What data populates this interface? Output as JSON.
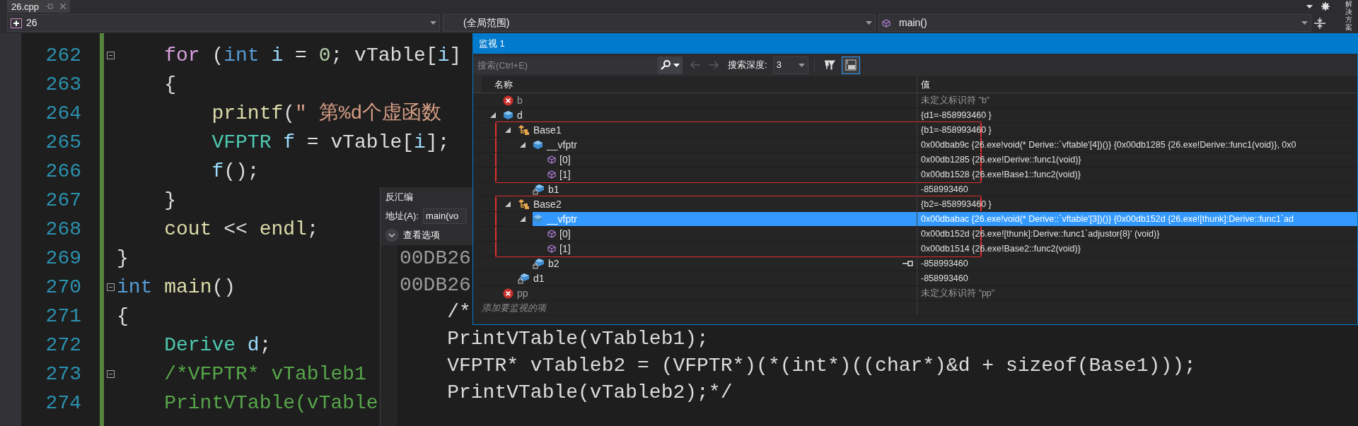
{
  "tab": {
    "title": "26.cpp"
  },
  "navbar": {
    "project": "26",
    "scope": "(全局范围)",
    "member": "main()"
  },
  "side_tab": {
    "label": "解决方案"
  },
  "editor": {
    "lines": [
      {
        "number": "262",
        "foldable": true,
        "tokens": [
          {
            "text": "    for",
            "kind": "control"
          },
          {
            "text": " (",
            "kind": "plain"
          },
          {
            "text": "int",
            "kind": "keyword"
          },
          {
            "text": " i",
            "kind": "variable"
          },
          {
            "text": " = ",
            "kind": "plain"
          },
          {
            "text": "0",
            "kind": "number"
          },
          {
            "text": "; vTable[",
            "kind": "plain"
          },
          {
            "text": "i",
            "kind": "variable"
          },
          {
            "text": "]",
            "kind": "plain"
          }
        ]
      },
      {
        "number": "263",
        "foldable": false,
        "tokens": [
          {
            "text": "    {",
            "kind": "plain"
          }
        ]
      },
      {
        "number": "264",
        "foldable": false,
        "tokens": [
          {
            "text": "        printf",
            "kind": "function"
          },
          {
            "text": "(",
            "kind": "plain"
          },
          {
            "text": "″ 第%d个虚函数",
            "kind": "string"
          }
        ]
      },
      {
        "number": "265",
        "foldable": false,
        "tokens": [
          {
            "text": "        VFPTR",
            "kind": "type"
          },
          {
            "text": " f",
            "kind": "variable"
          },
          {
            "text": " = vTable[",
            "kind": "plain"
          },
          {
            "text": "i",
            "kind": "variable"
          },
          {
            "text": "];",
            "kind": "plain"
          }
        ]
      },
      {
        "number": "266",
        "foldable": false,
        "tokens": [
          {
            "text": "        f",
            "kind": "variable"
          },
          {
            "text": "();",
            "kind": "plain"
          }
        ]
      },
      {
        "number": "267",
        "foldable": false,
        "tokens": [
          {
            "text": "    }",
            "kind": "plain"
          }
        ]
      },
      {
        "number": "268",
        "foldable": false,
        "tokens": [
          {
            "text": "    cout",
            "kind": "function"
          },
          {
            "text": " << ",
            "kind": "plain"
          },
          {
            "text": "endl",
            "kind": "function"
          },
          {
            "text": ";",
            "kind": "plain"
          }
        ]
      },
      {
        "number": "269",
        "foldable": false,
        "tokens": [
          {
            "text": "}",
            "kind": "plain"
          }
        ]
      },
      {
        "number": "270",
        "foldable": true,
        "tokens": [
          {
            "text": "int",
            "kind": "keyword"
          },
          {
            "text": " main",
            "kind": "function"
          },
          {
            "text": "()",
            "kind": "plain"
          }
        ]
      },
      {
        "number": "271",
        "foldable": false,
        "tokens": [
          {
            "text": "{",
            "kind": "plain"
          }
        ]
      },
      {
        "number": "272",
        "foldable": false,
        "tokens": [
          {
            "text": "    Derive",
            "kind": "type"
          },
          {
            "text": " d",
            "kind": "variable"
          },
          {
            "text": ";",
            "kind": "plain"
          }
        ]
      },
      {
        "number": "273",
        "foldable": true,
        "tokens": [
          {
            "text": "    /*VFPTR* vTableb1",
            "kind": "comment"
          }
        ]
      },
      {
        "number": "274",
        "foldable": false,
        "tokens": [
          {
            "text": "    PrintVTable(vTable",
            "kind": "comment"
          }
        ]
      }
    ]
  },
  "disassembly": {
    "title": "反汇编",
    "address_label": "地址(A):",
    "address": "main(vo",
    "options_label": "查看选项",
    "lines": [
      {
        "kind": "address",
        "text": "00DB26"
      },
      {
        "kind": "address",
        "text": "00DB26"
      },
      {
        "kind": "source",
        "text": "    /*"
      },
      {
        "kind": "source",
        "text": "    PrintVTable(vTableb1);"
      },
      {
        "kind": "source",
        "text": "    VFPTR* vTableb2 = (VFPTR*)(*(int*)((char*)&d + sizeof(Base1)));"
      },
      {
        "kind": "source",
        "text": "    PrintVTable(vTableb2);*/"
      }
    ]
  },
  "watch": {
    "title": "监视 1",
    "search": {
      "placeholder": "搜索(Ctrl+E)"
    },
    "nav": [
      {
        "kind": "back",
        "disabled": true
      },
      {
        "kind": "forward",
        "disabled": true
      }
    ],
    "depth_label": "搜索深度:",
    "depth": "3",
    "tools": [
      {
        "kind": "pin-filter",
        "selected": false
      },
      {
        "kind": "text-view",
        "selected": true
      }
    ],
    "columns": [
      "名称",
      "值"
    ],
    "items": [
      {
        "name": "b",
        "value": "未定义标识符 \"b\"",
        "kind": "error",
        "selected": false,
        "pinned": false,
        "framed": false
      },
      {
        "name": "d",
        "value": "{d1=-858993460 }",
        "kind": "object",
        "expanded": true,
        "selected": false,
        "pinned": false,
        "framed": false,
        "children": [
          {
            "name": "Base1",
            "value": "{b1=-858993460 }",
            "kind": "base",
            "expanded": true,
            "selected": false,
            "pinned": false,
            "framed": true,
            "children": [
              {
                "name": "__vfptr",
                "value": "0x00dbab9c {26.exe!void(* Derive::`vftable'[4])()} {0x00db1285 {26.exe!Derive::func1(void)}, 0x0",
                "kind": "object",
                "expanded": true,
                "selected": false,
                "pinned": false,
                "framed": false,
                "children": [
                  {
                    "name": "[0]",
                    "value": "0x00db1285 {26.exe!Derive::func1(void)}",
                    "kind": "method",
                    "selected": false,
                    "pinned": false,
                    "framed": false
                  },
                  {
                    "name": "[1]",
                    "value": "0x00db1528 {26.exe!Base1::func2(void)}",
                    "kind": "method",
                    "selected": false,
                    "pinned": false,
                    "framed": false
                  }
                ]
              },
              {
                "name": "b1",
                "value": "-858993460",
                "kind": "field",
                "selected": false,
                "pinned": false,
                "framed": false
              }
            ]
          },
          {
            "name": "Base2",
            "value": "{b2=-858993460 }",
            "kind": "base",
            "expanded": true,
            "selected": false,
            "pinned": false,
            "framed": true,
            "children": [
              {
                "name": "__vfptr",
                "value": "0x00dbabac {26.exe!void(* Derive::`vftable'[3])()} {0x00db152d {26.exe![thunk]:Derive::func1`ad",
                "kind": "object",
                "expanded": true,
                "selected": true,
                "pinned": false,
                "framed": false,
                "children": [
                  {
                    "name": "[0]",
                    "value": "0x00db152d {26.exe![thunk]:Derive::func1`adjustor{8}' (void)}",
                    "kind": "method",
                    "selected": false,
                    "pinned": false,
                    "framed": false
                  },
                  {
                    "name": "[1]",
                    "value": "0x00db1514 {26.exe!Base2::func2(void)}",
                    "kind": "method",
                    "selected": false,
                    "pinned": false,
                    "framed": false
                  }
                ]
              },
              {
                "name": "b2",
                "value": "-858993460",
                "kind": "field",
                "selected": false,
                "pinned": true,
                "framed": false
              }
            ]
          },
          {
            "name": "d1",
            "value": "-858993460",
            "kind": "field",
            "selected": false,
            "pinned": false,
            "framed": false
          }
        ]
      },
      {
        "name": "pp",
        "value": "未定义标识符 \"pp\"",
        "kind": "error",
        "selected": false,
        "pinned": false,
        "framed": false
      }
    ],
    "add_placeholder": "添加要监视的项"
  }
}
